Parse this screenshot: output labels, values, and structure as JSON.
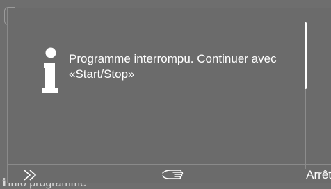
{
  "background": {
    "label": "Info programme",
    "info_glyph": "i"
  },
  "dialog": {
    "icon": "info-icon",
    "message": "Programme interrompu. Continuer avec «Start/Stop»"
  },
  "footer": {
    "skip_icon": "fast-forward-icon",
    "hand_icon": "hand-pointer-icon",
    "stop_label": "Arrêt"
  },
  "colors": {
    "dialog_bg": "#6b6b6b",
    "text": "#ffffff"
  }
}
